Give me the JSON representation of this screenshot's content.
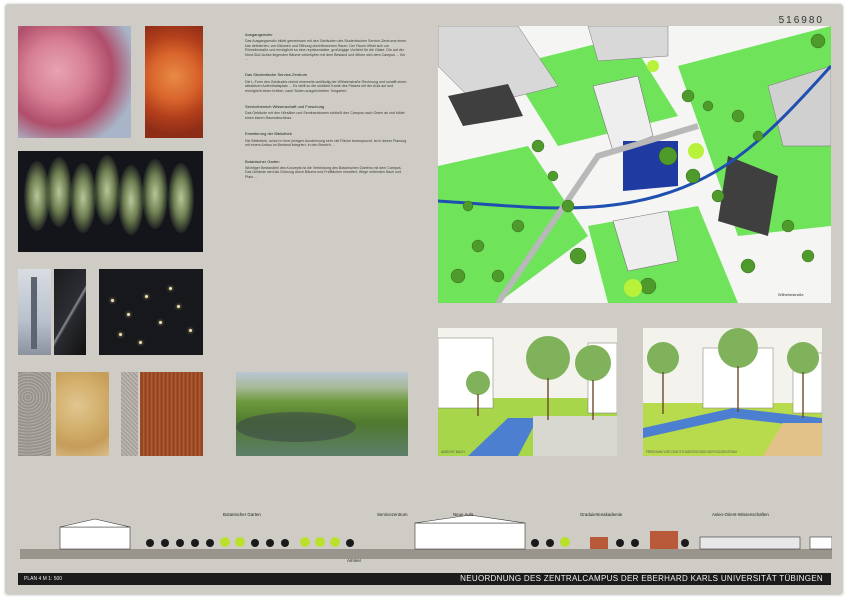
{
  "poster_code": "516980",
  "texts": [
    {
      "heading": "Ausgangsmotiv",
      "body": "Das Ausgangsmotiv bildet gemeinsam mit den Gebäuden des Studentischen Service-Zentrums einen klar definierten, von Bäumen und Öffnung durchflossenen Raum. Der Raum öffnet sich zur Rümelinstraße und ermöglicht so eine repräsentative, großzügige Vorfahrt für die Gäste. Die auf der Nord-Süd-Achse liegenden Bäume verknüpfen mit dem Bestand und öffnen sich dem Campus ... hin ..."
    },
    {
      "heading": "Das Studentische Service-Zentrum",
      "body": "Die L-Form des Gebäudes nimmt einerseits weitläufig der Wilhelmstraße Rechnung und schafft einen attraktiven Aufenthaltsplatz ... Es stellt so die südliche Kante des Platzes mit der Aula auf und ermöglicht einen breiten, nach Süden ausgerichteten 'Vorgarten'."
    },
    {
      "heading": "Servicebereich Wissenschaft und Forschung",
      "body": "Das Gebäude mit den Hörsälen und Seminarräumen schließt den Campus nach Osten ab und bildet einen klaren Raumabschluss."
    },
    {
      "heading": "Erweiterung der Bibliothek",
      "body": "Die Bibliothek, schon in ihrer jetzigen Ausdehnung sehr viel Fläche beansprucht, ist in dieser Planung mit einem Anbau im Bestand integriert, in den Bereich ..."
    },
    {
      "heading": "Botanischer Garten",
      "body": "Wichtiger Bestandteil des Konzepts ist die Verbindung des Botanischen Gartens mit dem Campus. Das Gelände wird als Grünzug durch Bäume und Freiflächen erweitert, Wege verbinden Bach und Platz ..."
    }
  ],
  "section_labels": [
    {
      "id": "botanischer",
      "text": "Botanischer Garten"
    },
    {
      "id": "servicezentrum",
      "text": "Servicezentrum"
    },
    {
      "id": "neue-aula",
      "text": "Neue Aula"
    },
    {
      "id": "graduierten",
      "text": "Graduiertenakademie"
    },
    {
      "id": "asien",
      "text": "Asien-Orient-Wissenschaften"
    }
  ],
  "street_label": "Ammer",
  "map_street_label": "Wilhelmstraße",
  "sketch_captions": [
    "ANSICHT BACH",
    "FREIRAUM VOR DEM STUDENTISCHEN SERVICEZENTRUM"
  ],
  "footer": {
    "plan": "PLAN 4  M 1: 500",
    "title": "NEUORDNUNG DES ZENTRALCAMPUS DER EBERHARD KARLS UNIVERSITÄT TÜBINGEN"
  },
  "colors": {
    "lawn": "#6fe35a",
    "water": "#1f4fb0",
    "tree": "#4e9a2a",
    "building_dark": "#3f3f3f",
    "sheet": "#cfccc6"
  }
}
